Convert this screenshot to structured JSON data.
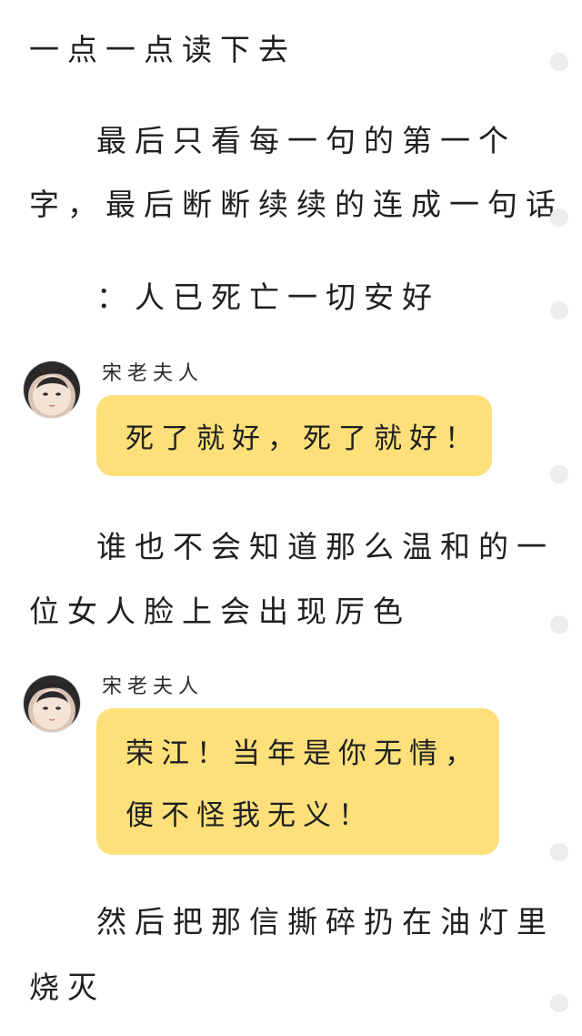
{
  "paragraphs": [
    "一点一点读下去",
    "最后只看每一句的第一个",
    "字，最后断断续续的连成一句话",
    "：人已死亡一切安好",
    "谁也不会知道那么温和的一",
    "位女人脸上会出现厉色",
    "然后把那信撕碎扔在油灯里",
    "烧灭"
  ],
  "messages": [
    {
      "speaker": "宋老夫人",
      "avatar_icon": "woman-portrait-avatar",
      "lines": [
        "死了就好，死了就好！"
      ]
    },
    {
      "speaker": "宋老夫人",
      "avatar_icon": "woman-portrait-avatar",
      "lines": [
        "荣江！当年是你无情，",
        "便不怪我无义！"
      ]
    }
  ],
  "colors": {
    "bubble": "#fde07a",
    "background": "#ffffff",
    "scroll_dot": "#ececec"
  }
}
